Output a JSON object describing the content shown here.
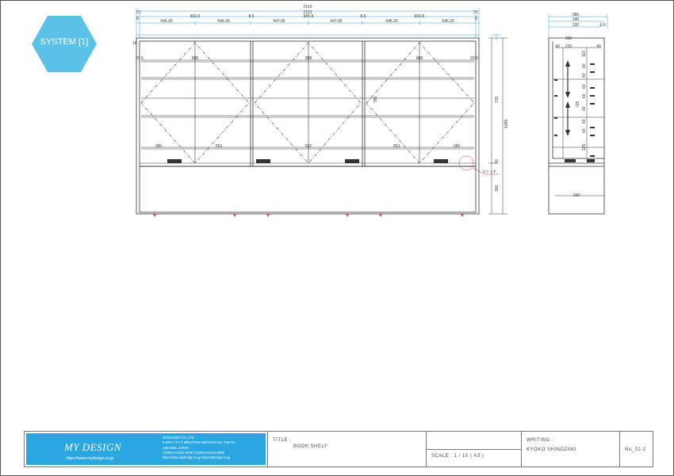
{
  "badge": {
    "label": "SYSTEM [1]",
    "color": "#5bc2e7"
  },
  "front_view": {
    "total_width": "2143",
    "inner_width": "2101",
    "left_edge": "21",
    "right_edge": "21",
    "edge_small_left": "8",
    "edge_small_right": "8",
    "module_dims": [
      "546.25",
      "603.5",
      "546.25",
      "8.5",
      "547.95",
      "605.9",
      "547.95",
      "8.5",
      "546.25",
      "603.5",
      "546.25"
    ],
    "left_side_dim": "18",
    "inner_left_label": "20.5",
    "inner_right_label": "20.5",
    "shelf_depth_labels": [
      "888",
      "888",
      "888"
    ],
    "bottom_labels": [
      "280",
      "553",
      "532",
      "553",
      "280"
    ],
    "mid_label": "785",
    "right_heights": [
      "715",
      "1085",
      "40",
      "300"
    ],
    "switch_label": "スイッチ",
    "accent_colors": {
      "dimension": "#2e9bd6",
      "marker": "#e0246c"
    }
  },
  "side_view": {
    "top_dims": [
      "380",
      "340",
      "330",
      "6.5"
    ],
    "depth_label": "300",
    "left_small": "40",
    "inner_label": "220",
    "right_small": "40",
    "shelf_pitches": [
      "110",
      "60",
      "60",
      "60",
      "60",
      "60",
      "60",
      "60",
      "125"
    ],
    "total_label": "725",
    "bottom_label": "320"
  },
  "title_block": {
    "company": "MYDESIGN CO.,LTD.",
    "logo_text": "MY DESIGN",
    "logo_url": "https://www.mydesign.co.jp",
    "info_lines": [
      "MYDESIGN CO.,LTD.",
      "5-109-1-4-1-7 MINATOKU MEGURO-KU TOKYO",
      "160-0005, JAPAN",
      "T:(000)-3-6412-0000  F:(000)-3-6412-0000",
      "http://www.mydesign.co.jp   lovemydesign.co.jp"
    ],
    "title_label": "TITLE :",
    "title_value": "BOOK SHELF",
    "scale_label": "SCALE : 1 / 10 ( A3 )",
    "writing_label": "WRITING :",
    "writer_name": "KYOKO SHINOZAKI",
    "sheet_no": "No_02-2"
  }
}
